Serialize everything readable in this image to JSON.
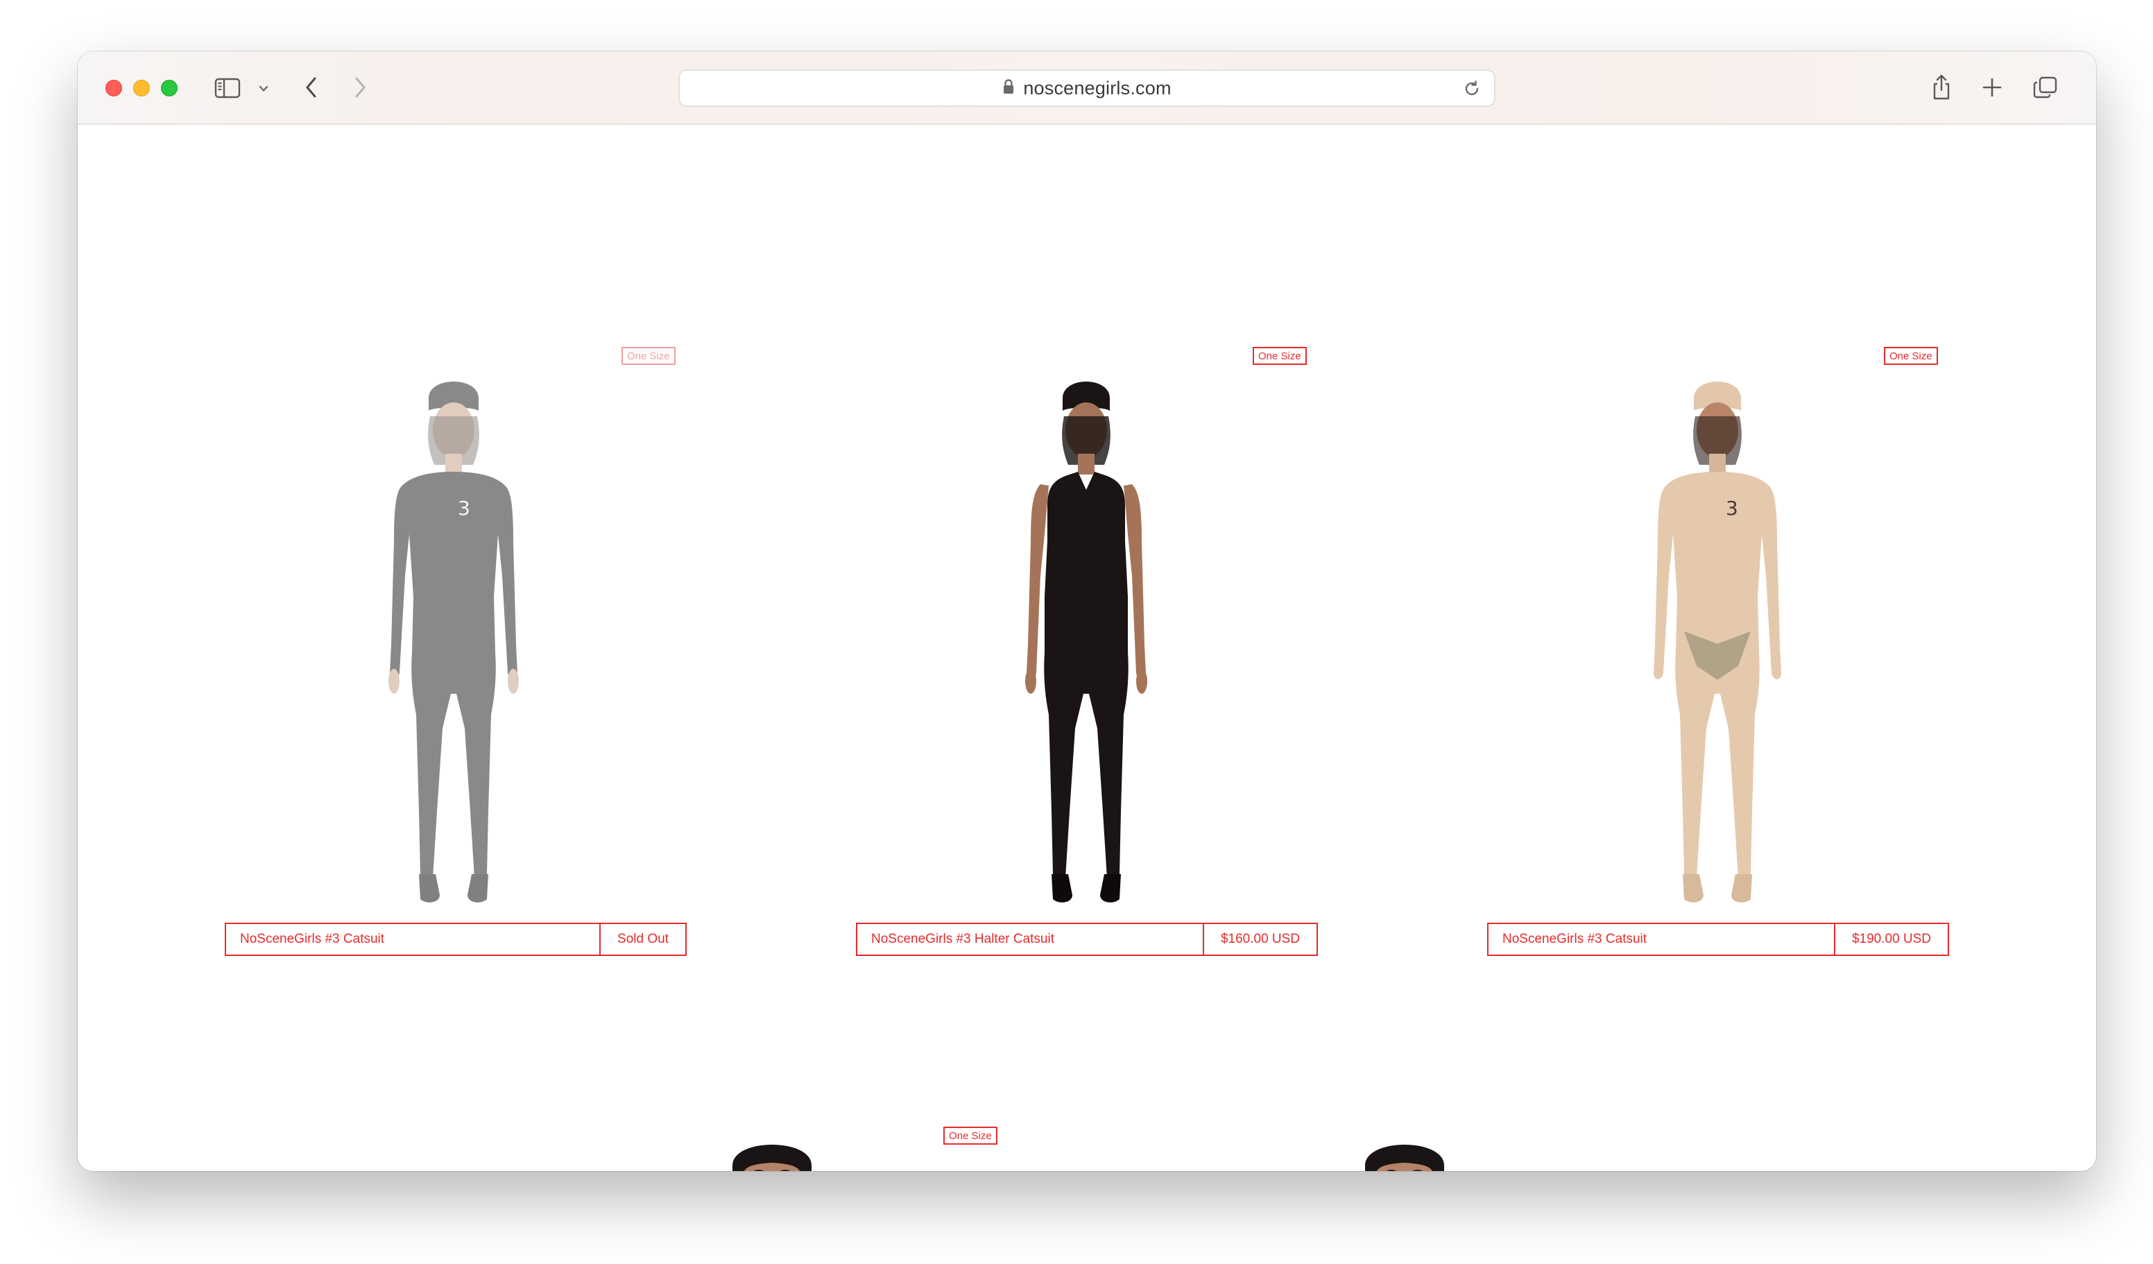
{
  "browser": {
    "url": "noscenegirls.com",
    "icons": {
      "sidebar": "sidebar-icon",
      "chevron": "chevron-down-icon",
      "back": "back-arrow-icon",
      "forward": "forward-arrow-icon",
      "lock": "lock-icon",
      "reload": "reload-icon",
      "share": "share-icon",
      "new_tab": "plus-icon",
      "tabs": "tab-overview-icon"
    }
  },
  "products": [
    {
      "size": "One Size",
      "name": "NoSceneGirls #3 Catsuit",
      "price": "Sold Out",
      "sold_out": true,
      "color": "#2a2a2a"
    },
    {
      "size": "One Size",
      "name": "NoSceneGirls #3 Halter Catsuit",
      "price": "$160.00 USD",
      "sold_out": false,
      "color": "#1a1414"
    },
    {
      "size": "One Size",
      "name": "NoSceneGirls #3 Catsuit",
      "price": "$190.00 USD",
      "sold_out": false,
      "color": "#e4c9ad"
    }
  ],
  "next_row": {
    "size": "One Size"
  },
  "colors": {
    "accent": "#e52b2b"
  }
}
